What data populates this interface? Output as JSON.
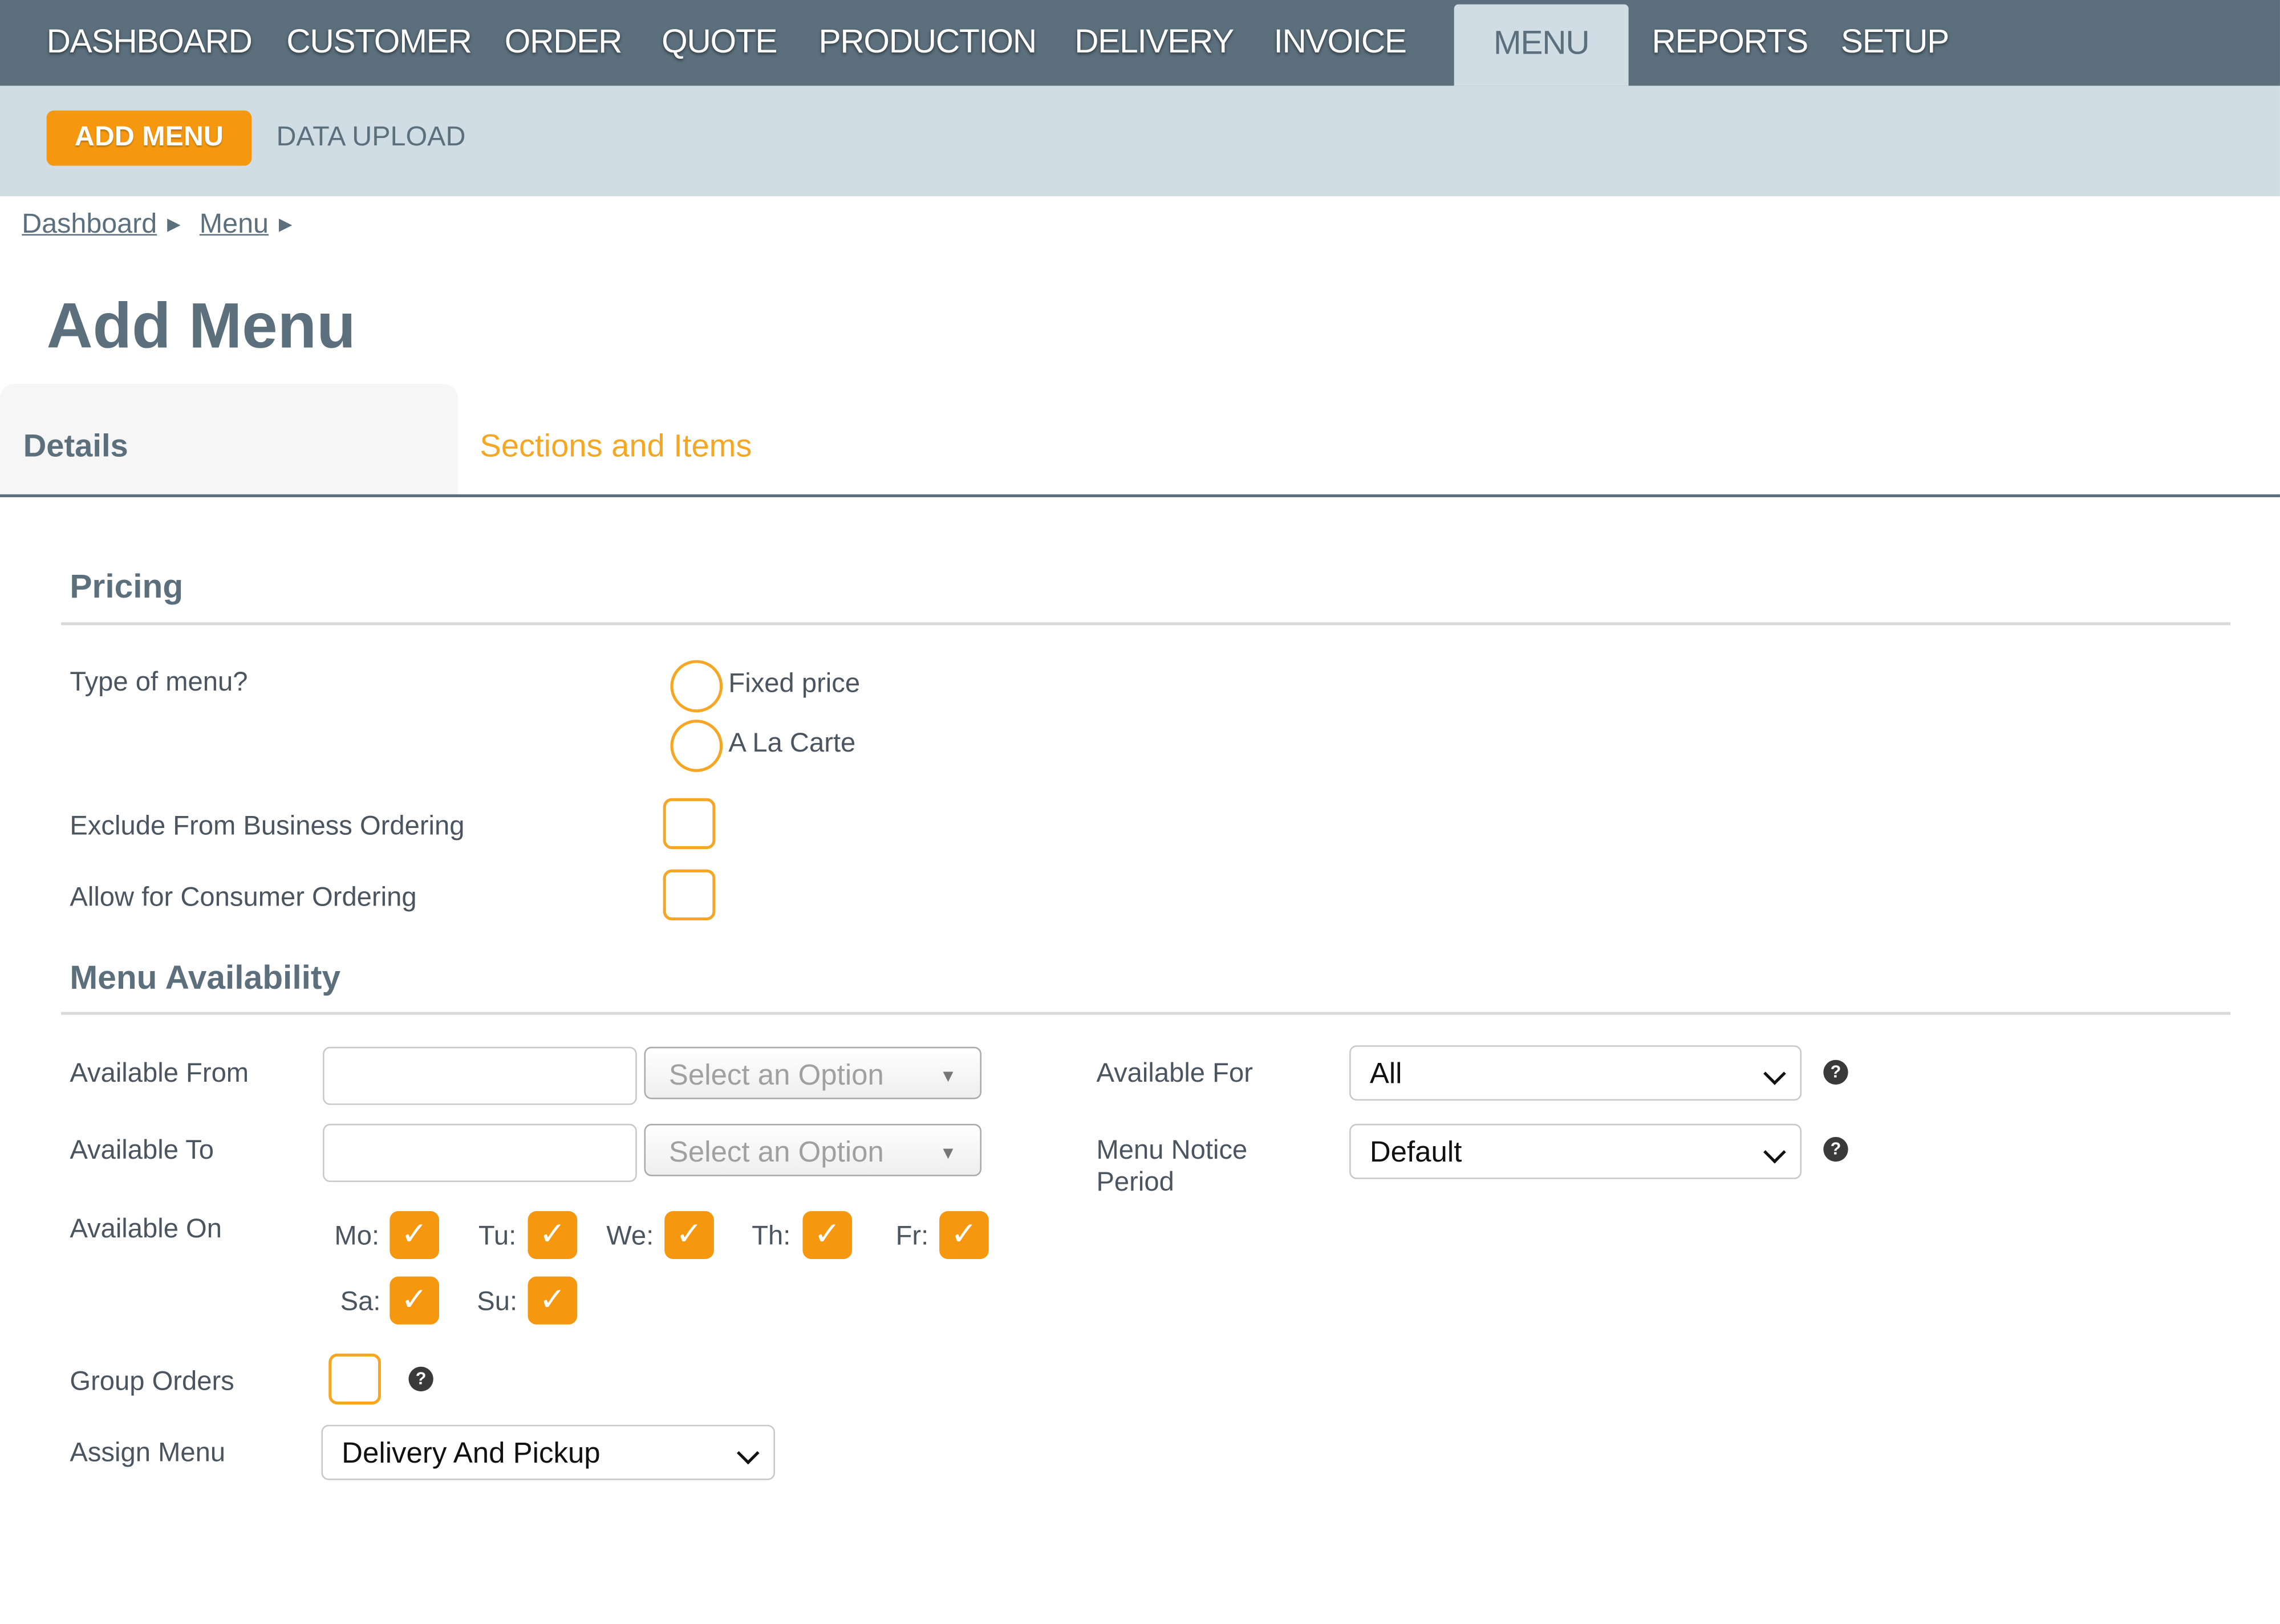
{
  "nav": {
    "items": [
      "DASHBOARD",
      "CUSTOMER",
      "ORDER",
      "QUOTE",
      "PRODUCTION",
      "DELIVERY",
      "INVOICE",
      "MENU",
      "REPORTS",
      "SETUP"
    ],
    "active": "MENU"
  },
  "subnav": {
    "add_menu": "ADD MENU",
    "data_upload": "DATA UPLOAD"
  },
  "breadcrumb": [
    "Dashboard",
    "Menu"
  ],
  "page_title": "Add Menu",
  "tabs": {
    "details": "Details",
    "sections": "Sections and Items",
    "active": "Details"
  },
  "pricing": {
    "heading": "Pricing",
    "type_label": "Type of menu?",
    "options": [
      "Fixed price",
      "A La Carte"
    ],
    "exclude_label": "Exclude From Business Ordering",
    "exclude_checked": false,
    "consumer_label": "Allow for Consumer Ordering",
    "consumer_checked": false
  },
  "availability": {
    "heading": "Menu Availability",
    "from_label": "Available From",
    "to_label": "Available To",
    "from_value": "",
    "to_value": "",
    "time_placeholder": "Select an Option",
    "on_label": "Available On",
    "days": [
      {
        "label": "Mo:",
        "checked": true
      },
      {
        "label": "Tu:",
        "checked": true
      },
      {
        "label": "We:",
        "checked": true
      },
      {
        "label": "Th:",
        "checked": true
      },
      {
        "label": "Fr:",
        "checked": true
      },
      {
        "label": "Sa:",
        "checked": true
      },
      {
        "label": "Su:",
        "checked": true
      }
    ],
    "group_orders_label": "Group Orders",
    "group_orders_checked": false,
    "assign_menu_label": "Assign Menu",
    "assign_menu_value": "Delivery And Pickup",
    "available_for_label": "Available For",
    "available_for_value": "All",
    "notice_label_line1": "Menu Notice",
    "notice_label_line2": "Period",
    "notice_value": "Default",
    "help_glyph": "?"
  },
  "check_glyph": "✓",
  "colors": {
    "nav_bg": "#5b6f7c",
    "subnav_bg": "#d1dde5",
    "accent": "#f5980f",
    "link_orange": "#f5a623"
  }
}
